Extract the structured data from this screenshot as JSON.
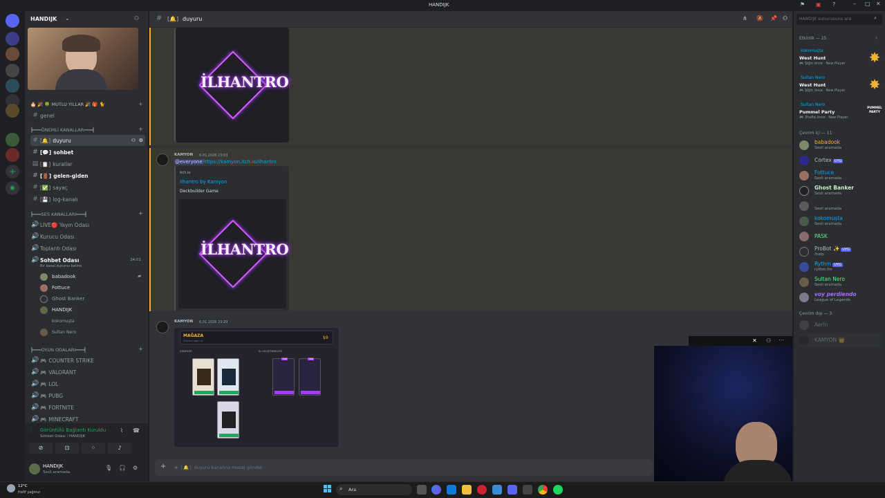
{
  "titlebar": {
    "title": "HANDIJK"
  },
  "server": {
    "name": "HANDIJK"
  },
  "sidebar": {
    "banner_text": "🎂 🎉 🍀 MUTLU YILLAR 🎉 🎁 🐈",
    "genel": "genel",
    "cat_important": "┣━━━ÖNEMLİ KANALLAR━━━┫",
    "channels": [
      {
        "label": "duyuru"
      },
      {
        "label": "sohbet"
      },
      {
        "label": "kurallar"
      },
      {
        "label": "gelen-giden"
      },
      {
        "label": "sayaç"
      },
      {
        "label": "log-kanalı"
      }
    ],
    "cat_voice": "┣━━━SES KANALLARI━━━┫",
    "voice_channels": [
      {
        "label": "LIVE🔴 Yayın Odası"
      },
      {
        "label": "Kurucu Odası"
      },
      {
        "label": "Toplantı Odası"
      },
      {
        "label": "Sohbet Odası"
      }
    ],
    "voice_time": "34:01",
    "voice_status": "Bir kanal durumu belirle",
    "voice_users": [
      {
        "name": "babadook"
      },
      {
        "name": "Fottuce"
      },
      {
        "name": "Ghost Banker"
      },
      {
        "name": "HANDIJK"
      },
      {
        "name": "kokomuşta"
      },
      {
        "name": "Sultan Nero"
      }
    ],
    "cat_games": "┣━━━OYUN ODALARI━━━┫",
    "game_channels": [
      {
        "label": "COUNTER STRIKE"
      },
      {
        "label": "VALORANT"
      },
      {
        "label": "LOL"
      },
      {
        "label": "PUBG"
      },
      {
        "label": "FORTNITE"
      },
      {
        "label": "MINECRAFT"
      }
    ],
    "connection": {
      "title": "Görüntülü Bağlantı Kuruldu",
      "subtitle": "Sohbet Odası / HANDIJK"
    },
    "user": {
      "name": "HANDIJK",
      "status": "Sesli aramada"
    }
  },
  "chat": {
    "channel_name": "duyuru",
    "msg1": {
      "author": "KAMYON",
      "time": "6.01.2026 23:03",
      "mention": "@everyone",
      "link": "https://kamyon.itch.io/ilhantro"
    },
    "embed": {
      "provider": "itch.io",
      "title": "Ilhantro by Kamyon",
      "desc": "Deckbuilder Game"
    },
    "logo_text": "İLHANTRO",
    "msg2": {
      "author": "KAMYON",
      "time": "6.01.2026 23:29"
    },
    "shop": {
      "title": "MAĞAZA",
      "subtitle": "Ürünleri satın al",
      "price": "$9",
      "left_label": "JOKERLER",
      "right_label": "EL GELİŞTİRMELERİ",
      "new": "YENİ"
    },
    "input_placeholder": "# ❘🔔❘ duyuru kanalına mesaj gönder"
  },
  "members": {
    "search_placeholder": "HANDIJK sunucusunu ara",
    "activity_header": "Etkinlik — 25",
    "activities": [
      {
        "user": "kokomuşta",
        "game": "West Hunt",
        "detail": "🎮 Şiğin önce · New Player"
      },
      {
        "user": "Sultan Nero",
        "game": "West Hunt",
        "detail": "🎮 Şiğin önce · New Player"
      },
      {
        "user": "Sultan Nero",
        "game": "Pummel Party",
        "detail": "🎮 3hafta önce · New Player",
        "badge": "PUMMEL PARTY"
      }
    ],
    "online_header": "Çevrim içi — 11",
    "online": [
      {
        "name": "babadook",
        "status": "Sesli aramada",
        "color": "#f0b232"
      },
      {
        "name": "Cortex",
        "status": "",
        "color": "#b5bac1",
        "badge": "UYG"
      },
      {
        "name": "Fottuce",
        "status": "Sesli aramada",
        "color": "#00a8fc"
      },
      {
        "name": "Ghost Banker",
        "status": "Sesli aramada",
        "color": "#c6f0c6"
      },
      {
        "name": "",
        "status": "Sesli aramada",
        "color": "#b5bac1"
      },
      {
        "name": "kokomuşta",
        "status": "Sesli aramada",
        "color": "#00a8fc"
      },
      {
        "name": "PASK",
        "status": "",
        "color": "#57f287"
      },
      {
        "name": "ProBot ✨",
        "status": "/help",
        "color": "#b5bac1",
        "badge": "UYG"
      },
      {
        "name": "Rythm",
        "status": "rythm.fm",
        "color": "#00a8fc",
        "badge": "UYG"
      },
      {
        "name": "Sultan Nero",
        "status": "Sesli aramada",
        "color": "#57f287"
      },
      {
        "name": "voy perdiendo",
        "status": "League of Legends",
        "color": "#a371f7"
      }
    ],
    "offline_header": "Çevrim dışı — 3",
    "offline": [
      {
        "name": "Aerin"
      },
      {
        "name": "KAMYON 👑"
      }
    ]
  },
  "taskbar": {
    "weather_temp": "12°C",
    "weather_desc": "Hafif yağmur",
    "search": "Ara"
  },
  "colors": {
    "accent": "#5865f2",
    "gold": "#f0b232",
    "green": "#23a55a"
  }
}
